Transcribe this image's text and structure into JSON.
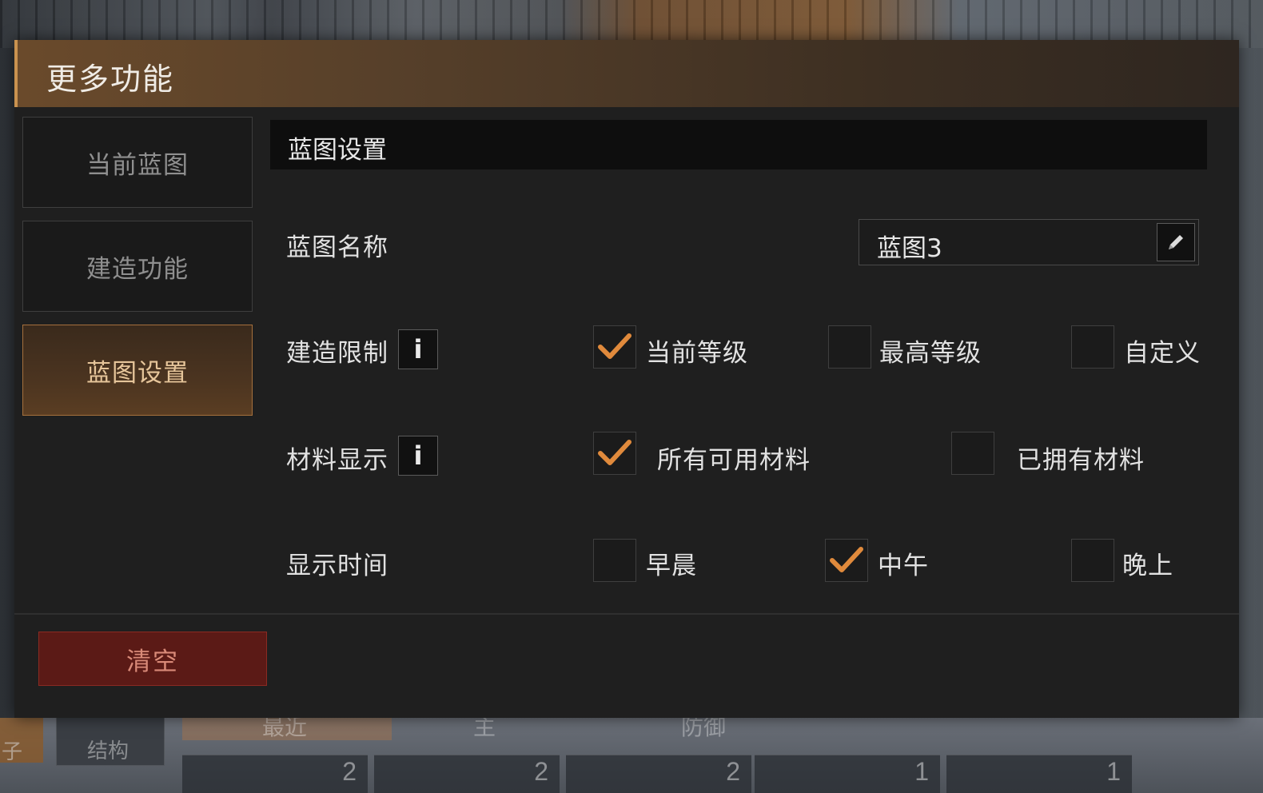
{
  "dialog": {
    "title": "更多功能"
  },
  "sidebar": {
    "items": [
      {
        "label": "当前蓝图",
        "active": false
      },
      {
        "label": "建造功能",
        "active": false
      },
      {
        "label": "蓝图设置",
        "active": true
      }
    ]
  },
  "content": {
    "section_title": "蓝图设置",
    "name_row": {
      "label": "蓝图名称",
      "value": "蓝图3",
      "edit_icon": "pencil-icon"
    },
    "build_limit": {
      "label": "建造限制",
      "info_icon": "info-icon",
      "options": [
        {
          "label": "当前等级",
          "checked": true
        },
        {
          "label": "最高等级",
          "checked": false
        },
        {
          "label": "自定义",
          "checked": false
        }
      ]
    },
    "material_display": {
      "label": "材料显示",
      "info_icon": "info-icon",
      "options": [
        {
          "label": "所有可用材料",
          "checked": true
        },
        {
          "label": "已拥有材料",
          "checked": false
        }
      ]
    },
    "display_time": {
      "label": "显示时间",
      "options": [
        {
          "label": "早晨",
          "checked": false
        },
        {
          "label": "中午",
          "checked": true
        },
        {
          "label": "晚上",
          "checked": false
        }
      ]
    }
  },
  "footer": {
    "clear_label": "清空"
  },
  "background": {
    "tabs": [
      "最近",
      "主",
      "防御"
    ],
    "struct_label": "结构",
    "side_label": "子",
    "slot_counts": [
      "2",
      "2",
      "2",
      "1",
      "1"
    ]
  },
  "colors": {
    "accent": "#e08a3c",
    "header": "#6a4a2b",
    "active_tab_text": "#e6c59a",
    "danger": "#5b1a16"
  }
}
